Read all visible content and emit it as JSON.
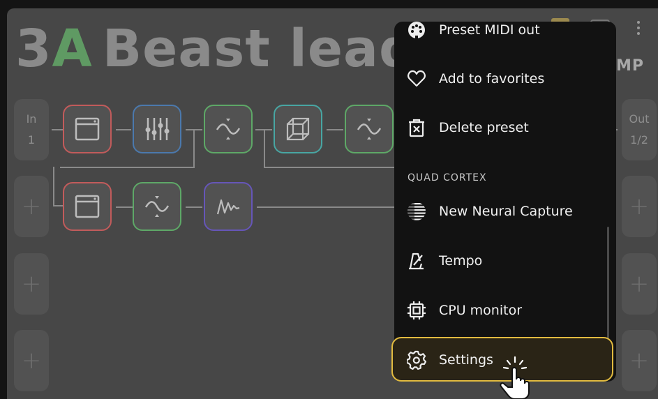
{
  "preset": {
    "scene_number": "3",
    "scene_letter": "A",
    "name": "Beast lead",
    "amp_tail": "MP"
  },
  "io": {
    "in_label": "In",
    "in_value": "1",
    "out_label": "Out",
    "out_value": "1/2",
    "add_glyph": "+"
  },
  "colors": {
    "scene_letter": "#5f9a63",
    "highlight_border": "#e2bb3f",
    "menu_bg": "#121212",
    "grid_bg": "#474747"
  },
  "menu": {
    "items": [
      {
        "label": "Preset MIDI out",
        "icon": "midi-plug-icon"
      },
      {
        "label": "Add to favorites",
        "icon": "heart-icon"
      },
      {
        "label": "Delete preset",
        "icon": "trash-icon"
      }
    ],
    "section": "QUAD CORTEX",
    "section_items": [
      {
        "label": "New Neural Capture",
        "icon": "neural-capture-icon"
      },
      {
        "label": "Tempo",
        "icon": "metronome-icon"
      },
      {
        "label": "CPU monitor",
        "icon": "cpu-chip-icon"
      },
      {
        "label": "Settings",
        "icon": "gear-icon"
      }
    ]
  }
}
